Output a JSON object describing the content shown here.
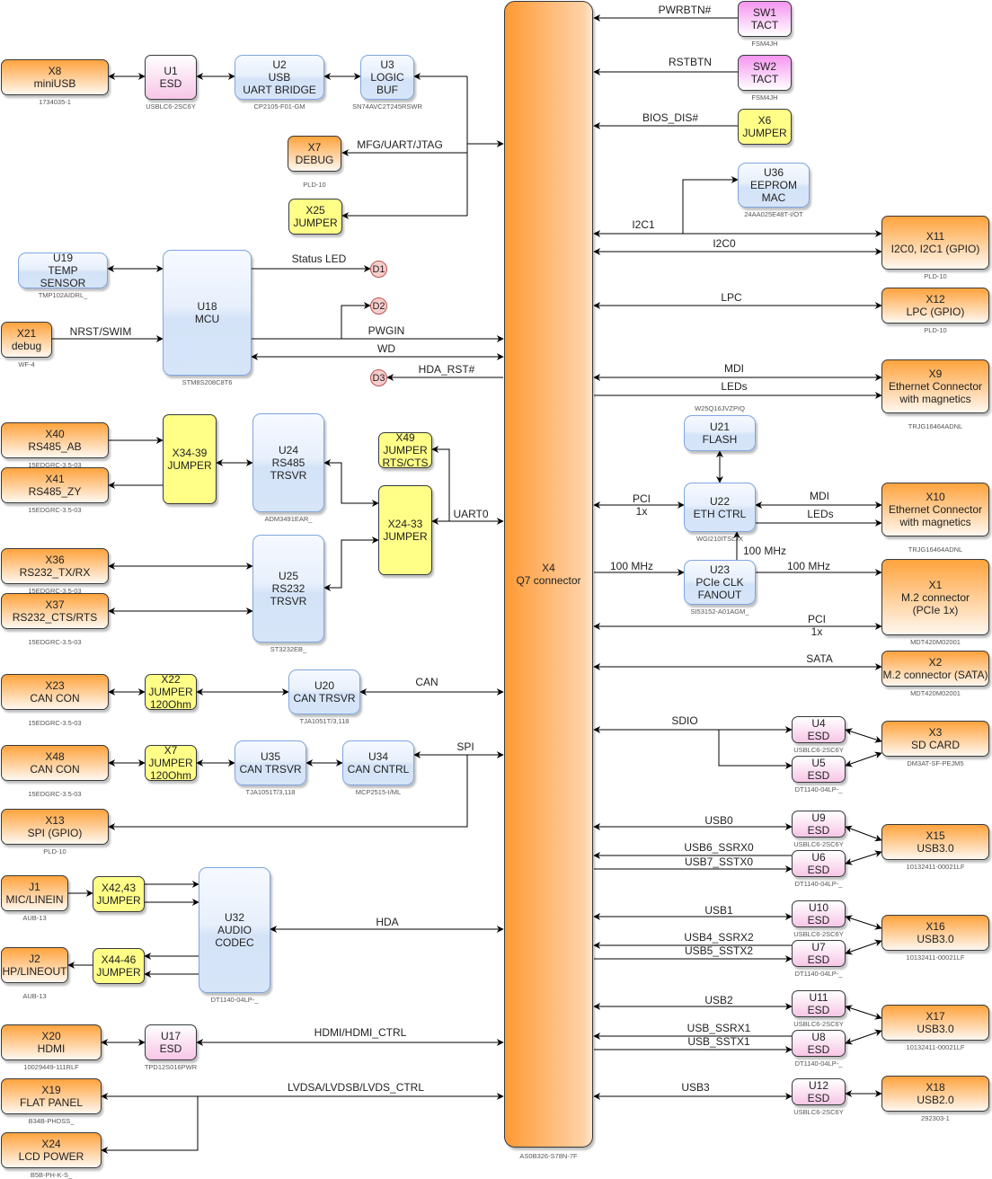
{
  "palette": {
    "connector": "#ffa33d",
    "chip": "#d4e3f7",
    "esd": "#f7c6e6",
    "switch": "#f595f0",
    "jumper": "#ffff88",
    "led": "#f8cecc"
  },
  "blocks": {
    "X4": {
      "label": "X4\nQ7 connector",
      "part": "AS0B326-S78N-7F"
    },
    "X8": {
      "label": "X8\nminiUSB",
      "part": "1734035-1"
    },
    "U1": {
      "label": "U1\nESD",
      "part": "USBLC6-2SC6Y"
    },
    "U2": {
      "label": "U2\nUSB\nUART BRIDGE",
      "part": "CP2105-F01-GM"
    },
    "U3": {
      "label": "U3\nLOGIC\nBUF",
      "part": "SN74AVC2T245RSWR"
    },
    "X7_debug": {
      "label": "X7\nDEBUG",
      "part": "PLD-10"
    },
    "X25": {
      "label": "X25\nJUMPER",
      "part": ""
    },
    "U19": {
      "label": "U19\nTEMP\nSENSOR",
      "part": "TMP102AIDRL_"
    },
    "U18": {
      "label": "U18\nMCU",
      "part": "STM8S208C8T6"
    },
    "X21": {
      "label": "X21\ndebug",
      "part": "WF-4"
    },
    "D1": {
      "label": "D1",
      "part": ""
    },
    "D2": {
      "label": "D2",
      "part": ""
    },
    "D3": {
      "label": "D3",
      "part": ""
    },
    "X40": {
      "label": "X40\nRS485_AB",
      "part": "15EDGRC-3.5-03"
    },
    "X41": {
      "label": "X41\nRS485_ZY",
      "part": "15EDGRC-3.5-03"
    },
    "X34_39": {
      "label": "X34-39\nJUMPER",
      "part": ""
    },
    "U24": {
      "label": "U24\nRS485\nTRSVR",
      "part": "ADM3491EAR_"
    },
    "X49": {
      "label": "X49\nJUMPER\nRTS/CTS",
      "part": ""
    },
    "X24_33": {
      "label": "X24-33\nJUMPER",
      "part": ""
    },
    "X36": {
      "label": "X36\nRS232_TX/RX",
      "part": "15EDGRC-3.5-03"
    },
    "X37": {
      "label": "X37\nRS232_CTS/RTS",
      "part": "15EDGRC-3.5-03"
    },
    "U25": {
      "label": "U25\nRS232\nTRSVR",
      "part": "ST3232EB_"
    },
    "X23": {
      "label": "X23\nCAN CON",
      "part": "15EDGRC-3.5-03"
    },
    "X22": {
      "label": "X22\nJUMPER\n120Ohm",
      "part": ""
    },
    "U20": {
      "label": "U20\nCAN TRSVR",
      "part": "TJA1051T/3,118"
    },
    "X48": {
      "label": "X48\nCAN CON",
      "part": "15EDGRC-3.5-03"
    },
    "X7_jumper": {
      "label": "X7\nJUMPER\n120Ohm",
      "part": ""
    },
    "U35": {
      "label": "U35\nCAN TRSVR",
      "part": "TJA1051T/3,118"
    },
    "U34": {
      "label": "U34\nCAN CNTRL",
      "part": "MCP2515-I/ML"
    },
    "X13": {
      "label": "X13\nSPI (GPIO)",
      "part": "PLD-10"
    },
    "J1": {
      "label": "J1\nMIC/LINEIN",
      "part": "AUB-13"
    },
    "X42_43": {
      "label": "X42,43\nJUMPER",
      "part": ""
    },
    "U32": {
      "label": "U32\nAUDIO\nCODEC",
      "part": "DT1140-04LP-_"
    },
    "J2": {
      "label": "J2\nHP/LINEOUT",
      "part": "AUB-13"
    },
    "X44_46": {
      "label": "X44-46\nJUMPER",
      "part": ""
    },
    "X20": {
      "label": "X20\nHDMI",
      "part": "10029449-111RLF"
    },
    "U17": {
      "label": "U17\nESD",
      "part": "TPD12S016PWR"
    },
    "X19": {
      "label": "X19\nFLAT PANEL",
      "part": "B34B-PHDSS_"
    },
    "X24": {
      "label": "X24\nLCD POWER",
      "part": "B5B-PH-K-S_"
    },
    "SW1": {
      "label": "SW1\nTACT",
      "part": "FSM4JH"
    },
    "SW2": {
      "label": "SW2\nTACT",
      "part": "FSM4JH"
    },
    "X6": {
      "label": "X6\nJUMPER",
      "part": ""
    },
    "U36": {
      "label": "U36\nEEPROM\nMAC",
      "part": "24AA025E48T-I/OT"
    },
    "X11": {
      "label": "X11\nI2C0, I2C1 (GPIO)",
      "part": "PLD-10"
    },
    "X12": {
      "label": "X12\nLPC (GPIO)",
      "part": "PLD-10"
    },
    "X9": {
      "label": "X9\nEthernet Connector\nwith magnetics",
      "part": "TRJG16464ADNL"
    },
    "U21": {
      "label": "U21\nFLASH",
      "part": "W25Q16JVZPIQ"
    },
    "U22": {
      "label": "U22\nETH CTRL",
      "part": "WGI210ITSLJX"
    },
    "X10": {
      "label": "X10\nEthernet Connector\nwith magnetics",
      "part": "TRJG16464ADNL"
    },
    "U23": {
      "label": "U23\nPCIe CLK\nFANOUT",
      "part": "SI53152-A01AGM_"
    },
    "X1": {
      "label": "X1\nM.2 connector\n(PCIe 1x)",
      "part": "MDT420M02001"
    },
    "X2": {
      "label": "X2\nM.2 connector (SATA)",
      "part": "MDT420M02001"
    },
    "U4": {
      "label": "U4\nESD",
      "part": "USBLC6-2SC6Y"
    },
    "U5": {
      "label": "U5\nESD",
      "part": "DT1140-04LP-_"
    },
    "X3": {
      "label": "X3\nSD CARD",
      "part": "DM3AT-SF-PEJM5"
    },
    "U9": {
      "label": "U9\nESD",
      "part": "USBLC6-2SC6Y"
    },
    "U6": {
      "label": "U6\nESD",
      "part": "DT1140-04LP-_"
    },
    "X15": {
      "label": "X15\nUSB3.0",
      "part": "10132411-00021LF"
    },
    "U10": {
      "label": "U10\nESD",
      "part": "USBLC6-2SC6Y"
    },
    "U7": {
      "label": "U7\nESD",
      "part": "DT1140-04LP-_"
    },
    "X16": {
      "label": "X16\nUSB3.0",
      "part": "10132411-00021LF"
    },
    "U11": {
      "label": "U11\nESD",
      "part": "USBLC6-2SC6Y"
    },
    "U8": {
      "label": "U8\nESD",
      "part": "DT1140-04LP-_"
    },
    "X17": {
      "label": "X17\nUSB3.0",
      "part": "10132411-00021LF"
    },
    "U12": {
      "label": "U12\nESD",
      "part": "USBLC6-2SC6Y"
    },
    "X18": {
      "label": "X18\nUSB2.0",
      "part": "292303-1"
    }
  },
  "signals": {
    "mfg_uart_jtag": "MFG/UART/JTAG",
    "status_led": "Status LED",
    "nrst_swim": "NRST/SWIM",
    "pwgin": "PWGIN",
    "wd": "WD",
    "hda_rst": "HDA_RST#",
    "uart0": "UART0",
    "can": "CAN",
    "spi": "SPI",
    "hda": "HDA",
    "hdmi": "HDMI/HDMI_CTRL",
    "lvds": "LVDSA/LVDSB/LVDS_CTRL",
    "pwrbtn": "PWRBTN#",
    "rstbtn": "RSTBTN",
    "bios_dis": "BIOS_DIS#",
    "i2c1": "I2C1",
    "i2c0": "I2C0",
    "lpc": "LPC",
    "mdi": "MDI",
    "leds": "LEDs",
    "pci_a": "PCI",
    "pci_a_width": "1x",
    "mdi2": "MDI",
    "leds2": "LEDs",
    "clk_u22": "100 MHz",
    "clk_in": "100 MHz",
    "clk_x1": "100 MHz",
    "pci_b": "PCI",
    "pci_b_width": "1x",
    "sata": "SATA",
    "sdio": "SDIO",
    "usb0": "USB0",
    "usb6_ssrx0": "USB6_SSRX0",
    "usb7_sstx0": "USB7_SSTX0",
    "usb1": "USB1",
    "usb4_ssrx2": "USB4_SSRX2",
    "usb5_sstx2": "USB5_SSTX2",
    "usb2": "USB2",
    "usb_ssrx1": "USB_SSRX1",
    "usb_sstx1": "USB_SSTX1",
    "usb3": "USB3"
  }
}
